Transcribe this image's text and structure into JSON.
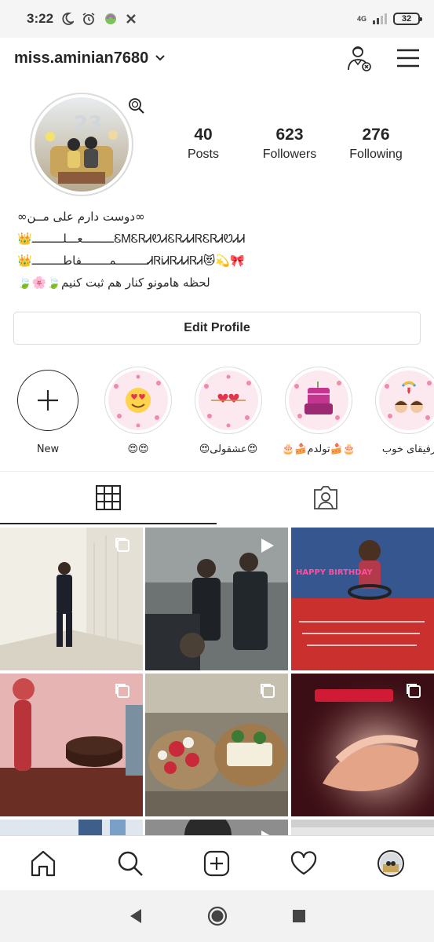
{
  "status_bar": {
    "time": "3:22",
    "network": "4G",
    "battery": "32"
  },
  "header": {
    "username": "miss.aminian7680"
  },
  "profile": {
    "stats": [
      {
        "value": "40",
        "label": "Posts"
      },
      {
        "value": "623",
        "label": "Followers"
      },
      {
        "value": "276",
        "label": "Following"
      }
    ],
    "bio_lines": [
      "∞دوست دارم علی مــن∞",
      "👑ـــــــــعـــلـــــــــᏋᎷᏋᏒᏗᏬᏗᏋᏒᏗᏗᏒᏋᏒᏗᏬᏗᏗــــی😻💫🎀",
      "👑ـــــــــمــــــــفاطـــــــــᏗᏒᎥᏗᏒᏗᏗᏒᏗ😻💫🎀",
      "🍃🌸🍃لحظه هامونو کنار هم ثبت کنیم"
    ],
    "edit_button": "Edit Profile"
  },
  "highlights": [
    {
      "label": "New",
      "icon": "plus-icon"
    },
    {
      "label": "😍😍",
      "icon": "heart-eyes-emoji"
    },
    {
      "label": "😍عشقولی😍",
      "icon": "hearts-icon"
    },
    {
      "label": "🎂🍰تولدم🍰🎂",
      "icon": "birthday-cake-icon"
    },
    {
      "label": "رفیقای خوب",
      "icon": "friends-icon"
    }
  ],
  "tabs": [
    {
      "name": "grid",
      "icon": "grid-icon"
    },
    {
      "name": "tagged",
      "icon": "tagged-person-icon"
    }
  ],
  "posts": [
    {
      "type": "multiple",
      "badge_icon": "carousel-icon",
      "colors": [
        "#f2efe6",
        "#c9c3b4"
      ]
    },
    {
      "type": "video",
      "badge_icon": "video-play-icon",
      "colors": [
        "#8a8f8f",
        "#2b2f33"
      ]
    },
    {
      "type": "image",
      "overlay_text": "HAPPY BIRTHDAY",
      "colors": [
        "#c23a3a",
        "#2f4f8f"
      ]
    },
    {
      "type": "multiple",
      "badge_icon": "carousel-icon",
      "colors": [
        "#d88a8a",
        "#5a2e2e"
      ]
    },
    {
      "type": "multiple",
      "badge_icon": "carousel-icon",
      "colors": [
        "#7a6a55",
        "#e9e3d5"
      ]
    },
    {
      "type": "multiple",
      "badge_icon": "carousel-icon",
      "colors": [
        "#e0a68b",
        "#3b0d14"
      ]
    },
    {
      "type": "image",
      "colors": [
        "#7aa0c8",
        "#dfe6ee"
      ]
    },
    {
      "type": "video",
      "badge_icon": "video-play-icon",
      "colors": [
        "#3a3a3a",
        "#8d8d8d"
      ]
    },
    {
      "type": "image",
      "colors": [
        "#e6e6e6",
        "#cfcfcf"
      ]
    }
  ],
  "colors": {
    "text": "#262626",
    "border": "#dbdbdb",
    "highlight_bg": "#fbe9ef"
  }
}
